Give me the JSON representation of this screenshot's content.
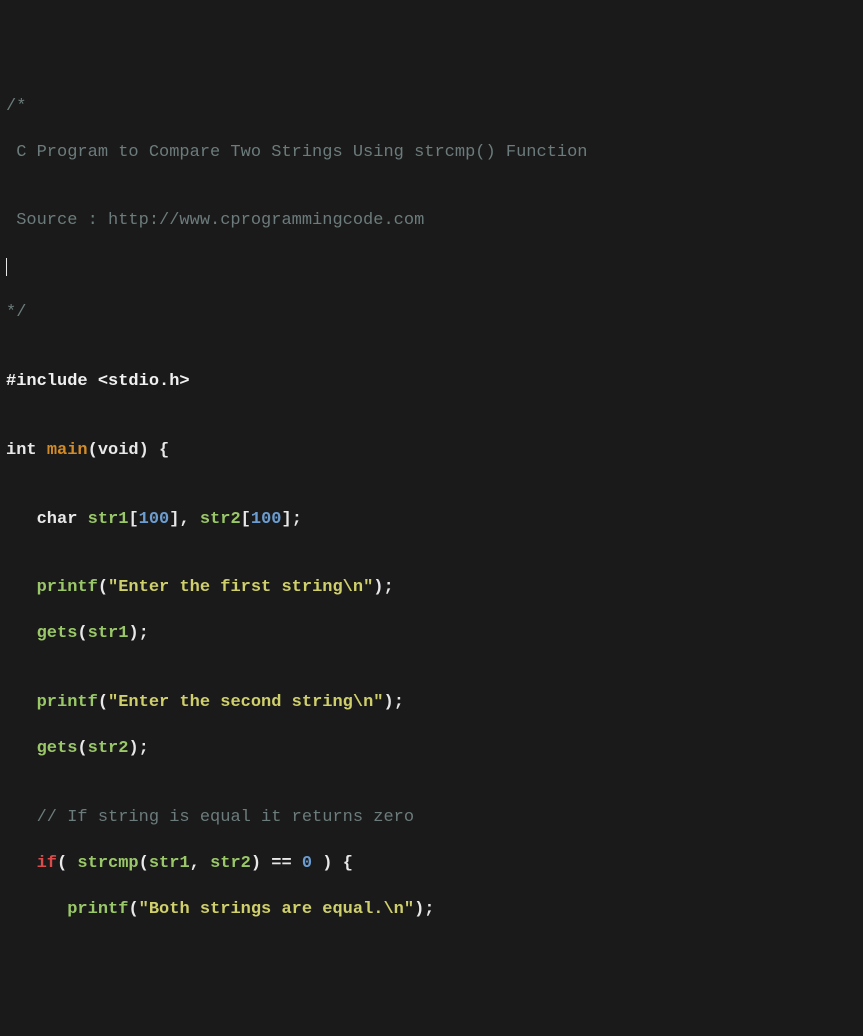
{
  "editor": {
    "language": "c",
    "lines": {
      "l1": "/*",
      "l2": " C Program to Compare Two Strings Using strcmp() Function",
      "l3_blank": "",
      "l4": " Source : http://www.cprogrammingcode.com",
      "l5_cursor": "",
      "l6": "*/",
      "l7_blank": "",
      "include_directive": "#include <stdio.h>",
      "blank_after_include": "",
      "kw_int": "int",
      "fn_main": "main",
      "kw_void": "void",
      "blank_after_main": "",
      "kw_char": "char",
      "id_str1": "str1",
      "arrsize_100a": "100",
      "id_str2": "str2",
      "arrsize_100b": "100",
      "blank_after_decl": "",
      "fn_printf1": "printf",
      "str_first": "\"Enter the first string\\n\"",
      "fn_gets1": "gets",
      "id_str1b": "str1",
      "blank_after_first": "",
      "fn_printf2": "printf",
      "str_second": "\"Enter the second string\\n\"",
      "fn_gets2": "gets",
      "id_str2b": "str2",
      "blank_after_second": "",
      "comment_ifnote": "// If string is equal it returns zero",
      "kw_if": "if",
      "fn_strcmp": "strcmp",
      "id_str1c": "str1",
      "id_str2c": "str2",
      "op_eq": "==",
      "num_zero": "0",
      "fn_printf3": "printf",
      "str_equal": "\"Both strings are equal.\\n\""
    }
  }
}
